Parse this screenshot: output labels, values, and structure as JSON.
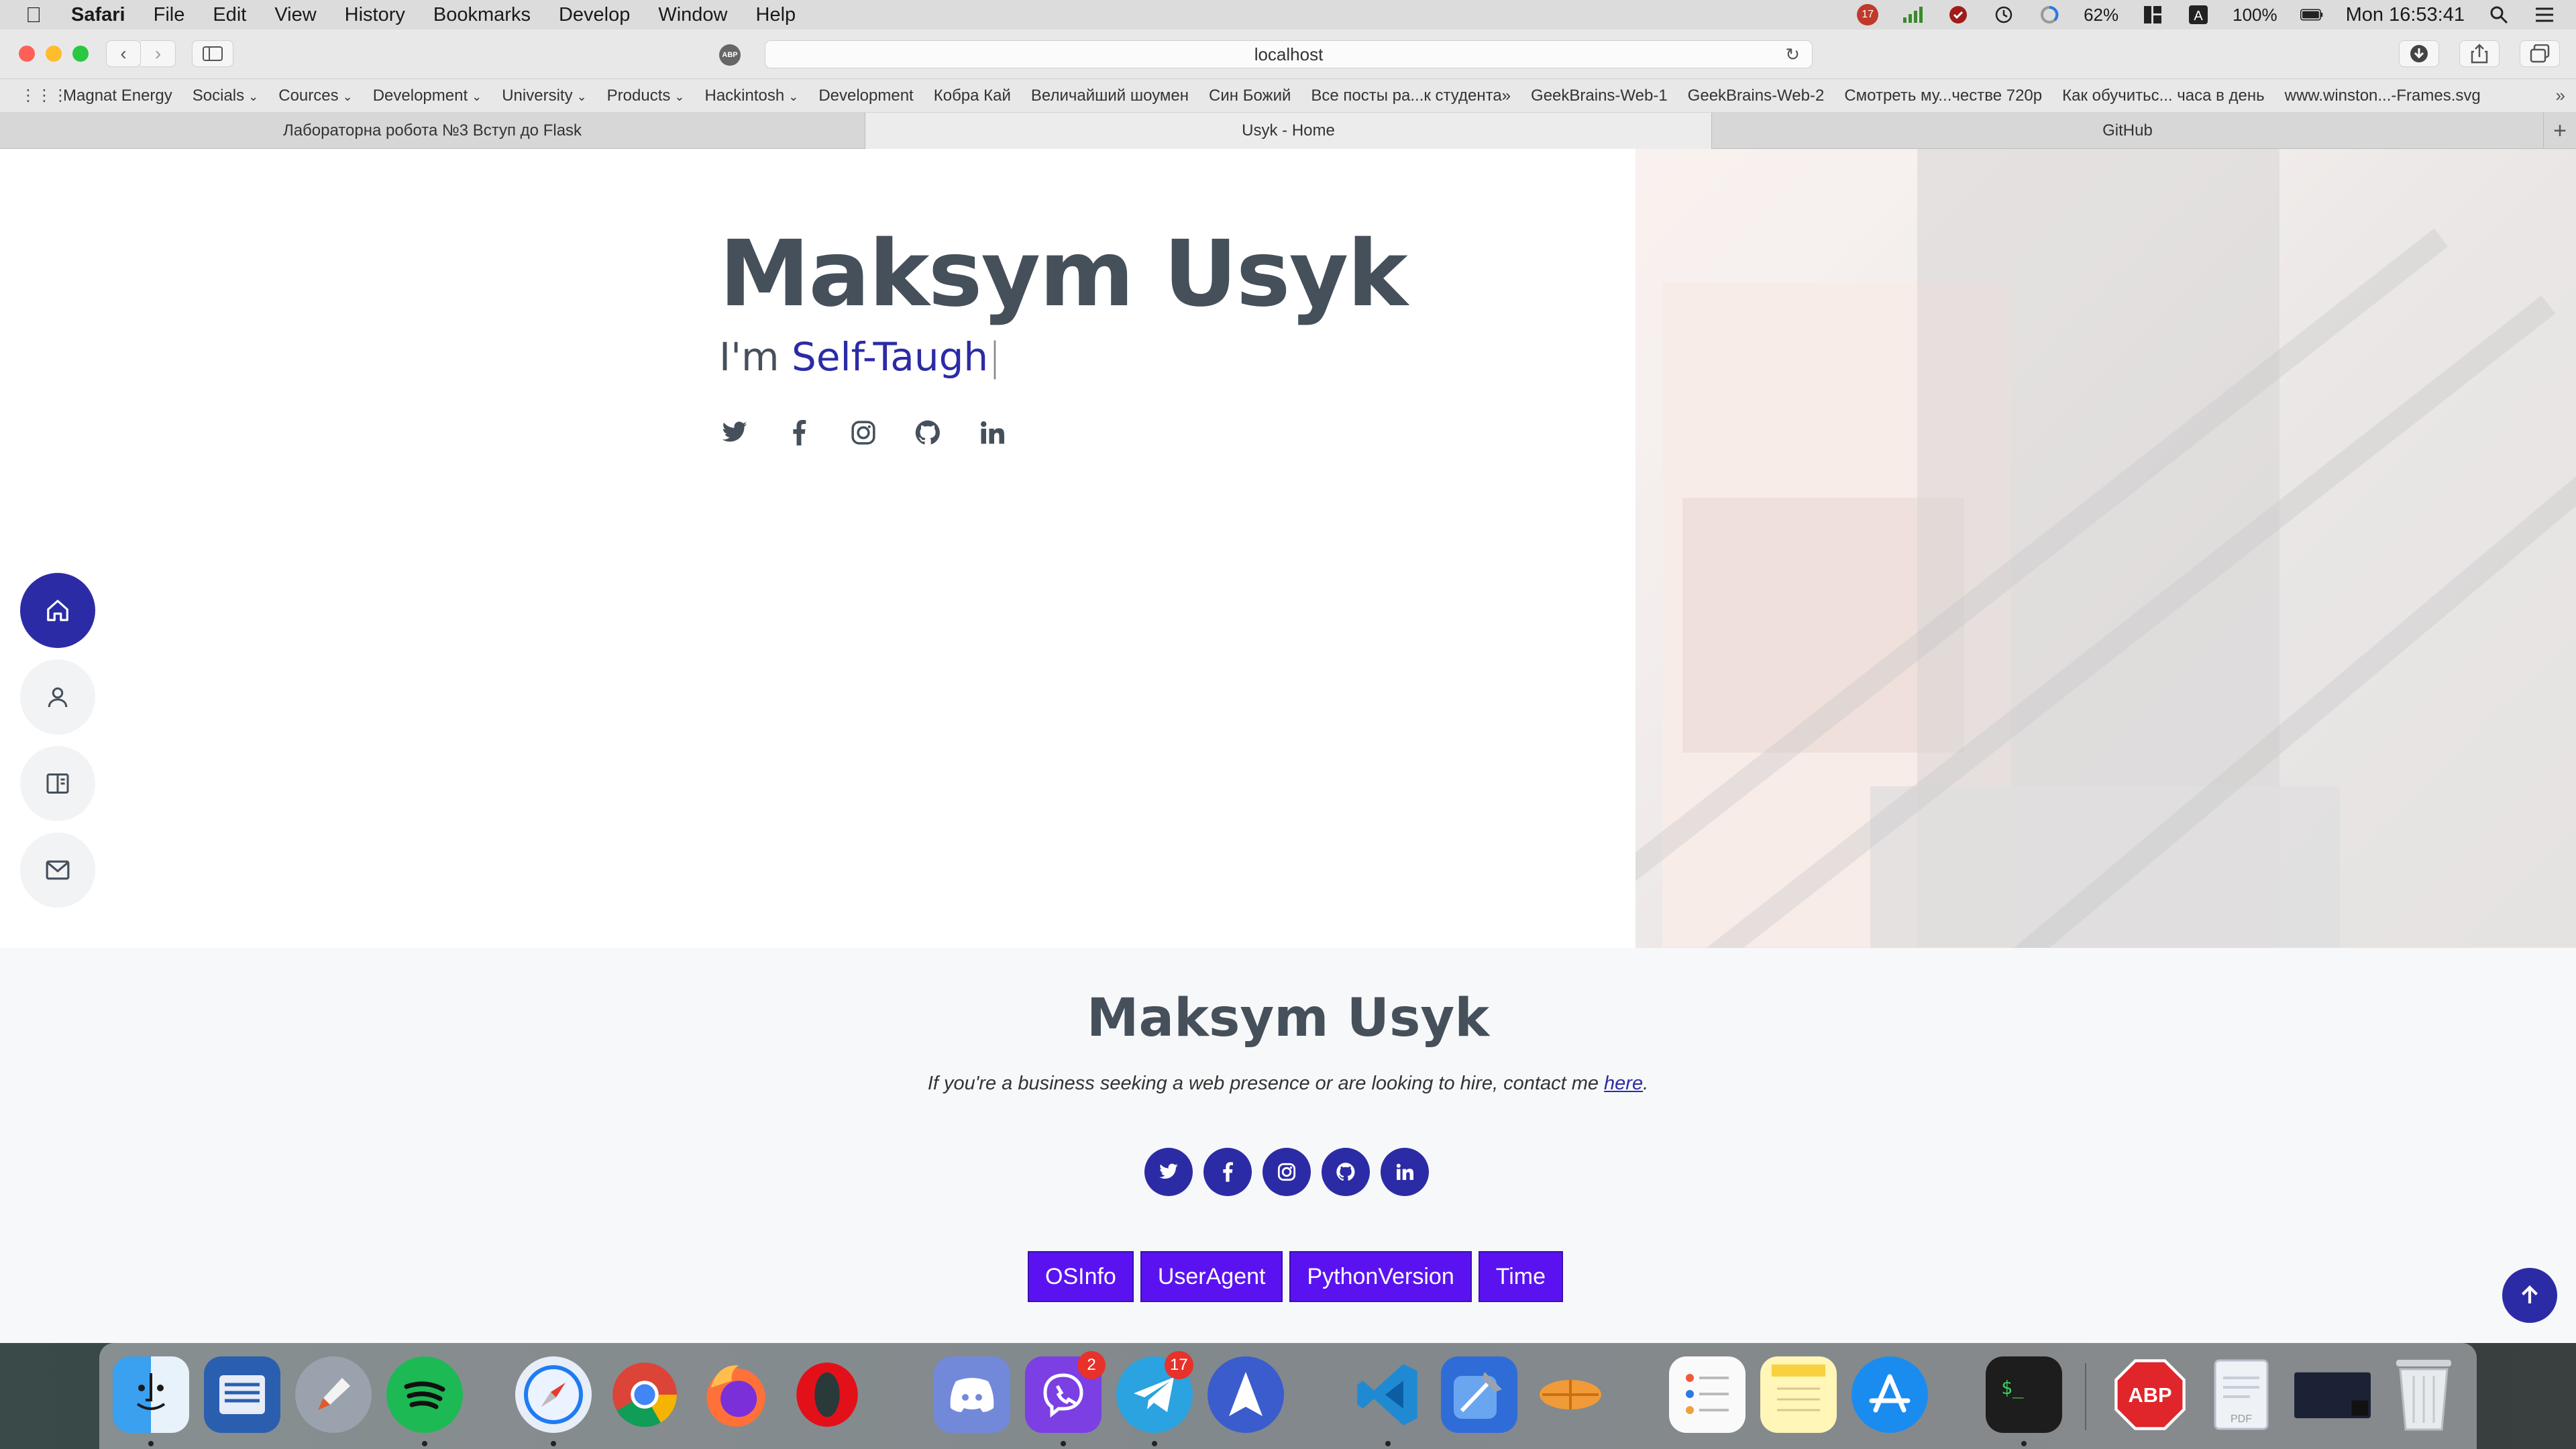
{
  "menubar": {
    "app_name": "Safari",
    "menus": [
      "File",
      "Edit",
      "View",
      "History",
      "Bookmarks",
      "Develop",
      "Window",
      "Help"
    ],
    "status": {
      "wifi_badge": "17",
      "battery_percent": "62%",
      "battery_full": "100%",
      "clock": "Mon 16:53:41"
    }
  },
  "browser": {
    "address": "localhost",
    "adblock_label": "ABP",
    "favorites": [
      {
        "label": "Magnat Energy",
        "menu": false
      },
      {
        "label": "Socials",
        "menu": true
      },
      {
        "label": "Cources",
        "menu": true
      },
      {
        "label": "Development",
        "menu": true
      },
      {
        "label": "University",
        "menu": true
      },
      {
        "label": "Products",
        "menu": true
      },
      {
        "label": "Hackintosh",
        "menu": true
      },
      {
        "label": "Development",
        "menu": false
      },
      {
        "label": "Кобра Кай",
        "menu": false
      },
      {
        "label": "Величайший шоумен",
        "menu": false
      },
      {
        "label": "Син Божий",
        "menu": false
      },
      {
        "label": "Все посты ра...к студента»",
        "menu": false
      },
      {
        "label": "GeekBrains-Web-1",
        "menu": false
      },
      {
        "label": "GeekBrains-Web-2",
        "menu": false
      },
      {
        "label": "Смотреть му...честве 720p",
        "menu": false
      },
      {
        "label": "Как обучитьс... часа в день",
        "menu": false
      },
      {
        "label": "www.winston...-Frames.svg",
        "menu": false
      }
    ],
    "tabs": [
      {
        "label": "Лабораторна робота №3 Вступ до Flask",
        "active": false
      },
      {
        "label": "Usyk - Home",
        "active": true
      },
      {
        "label": "GitHub",
        "active": false
      }
    ]
  },
  "page": {
    "hero": {
      "name": "Maksym Usyk",
      "sub_prefix": "I'm ",
      "sub_typed": "Self-Taugh",
      "cursor": "|"
    },
    "footer": {
      "name": "Maksym Usyk",
      "text_before": "If you're a business seeking a web presence or are looking to hire, contact me ",
      "link": "here",
      "text_after": ".",
      "buttons": [
        "OSInfo",
        "UserAgent",
        "PythonVersion",
        "Time"
      ]
    },
    "accent": "#2c2ba6",
    "button_color": "#5a13f0"
  },
  "dock": {
    "badges": {
      "viber": "2",
      "telegram": "17"
    }
  }
}
